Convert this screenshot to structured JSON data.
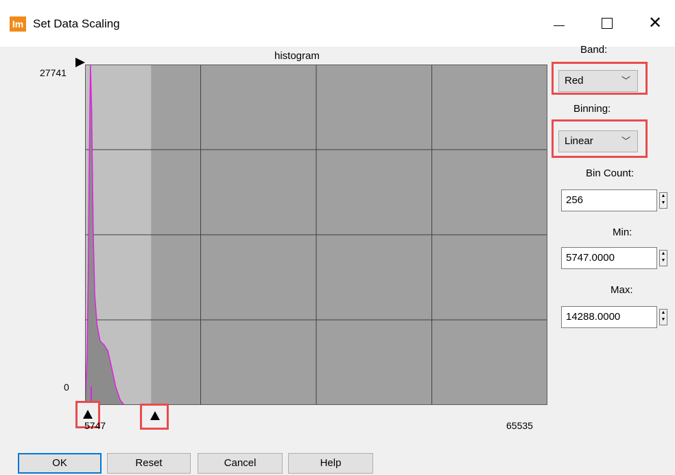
{
  "window": {
    "title": "Set Data Scaling",
    "app_icon_text": "Im"
  },
  "histogram": {
    "title": "histogram",
    "y_max_label": "27741",
    "y_min_label": "0",
    "x_min_label": "5747",
    "x_max_label": "65535",
    "x_range": [
      5747,
      65535
    ],
    "y_range": [
      0,
      27741
    ],
    "curve_color": "#e020e0",
    "stretch_min": 5747,
    "stretch_max": 14288,
    "curve": [
      [
        5747,
        0
      ],
      [
        6000,
        4000
      ],
      [
        6150,
        10000
      ],
      [
        6300,
        20000
      ],
      [
        6450,
        27741
      ],
      [
        6600,
        24000
      ],
      [
        6800,
        14000
      ],
      [
        7000,
        9000
      ],
      [
        7300,
        6500
      ],
      [
        7700,
        5200
      ],
      [
        8200,
        4900
      ],
      [
        8700,
        4400
      ],
      [
        9200,
        3000
      ],
      [
        9700,
        1500
      ],
      [
        10300,
        400
      ],
      [
        10800,
        0
      ],
      [
        65535,
        0
      ]
    ]
  },
  "panel": {
    "band_label": "Band:",
    "band_value": "Red",
    "binning_label": "Binning:",
    "binning_value": "Linear",
    "bin_count_label": "Bin Count:",
    "bin_count_value": "256",
    "min_label": "Min:",
    "min_value": "5747.0000",
    "max_label": "Max:",
    "max_value": "14288.0000"
  },
  "buttons": {
    "ok": "OK",
    "reset": "Reset",
    "cancel": "Cancel",
    "help": "Help"
  },
  "colors": {
    "highlight": "#e84c4c",
    "plot_bg": "#a0a0a0",
    "stretch_bg": "#c0c0c0"
  }
}
